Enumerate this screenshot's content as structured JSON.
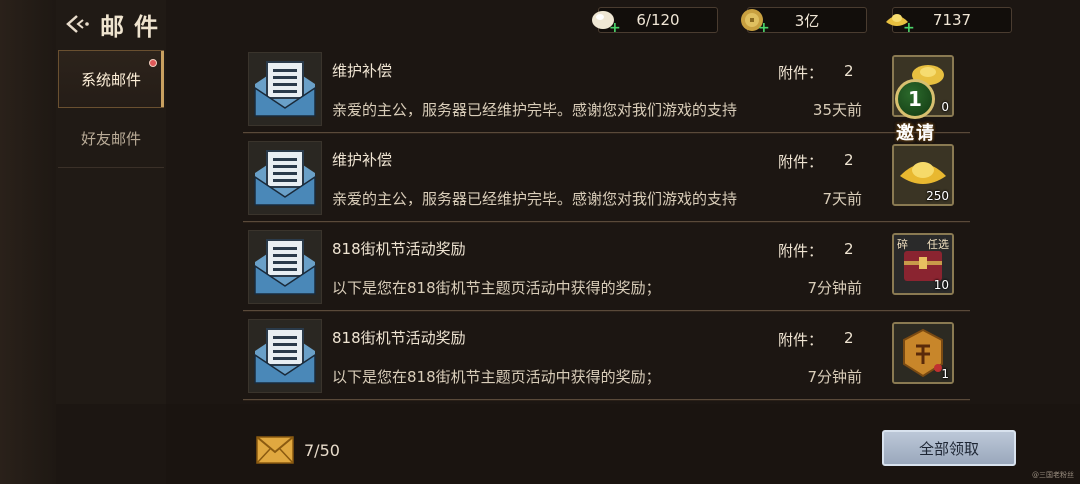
{
  "header": {
    "title": "邮件"
  },
  "sidebar": {
    "items": [
      {
        "label": "系统邮件",
        "active": true,
        "has_dot": true
      },
      {
        "label": "好友邮件",
        "active": false,
        "has_dot": false
      }
    ]
  },
  "resources": [
    {
      "icon": "pearl-icon",
      "value": "6/120"
    },
    {
      "icon": "coin-icon",
      "value": "3亿"
    },
    {
      "icon": "gold-ingot-icon",
      "value": "7137"
    }
  ],
  "mails": [
    {
      "title": "维护补偿",
      "attach_label": "附件：",
      "attach_count": "2",
      "body": "亲爱的主公，服务器已经维护完毕。感谢您对我们游戏的支持",
      "time": "35天前",
      "reward_icon": "gold-ingot-pile-icon",
      "reward_count": "0"
    },
    {
      "title": "维护补偿",
      "attach_label": "附件：",
      "attach_count": "2",
      "body": "亲爱的主公，服务器已经维护完毕。感谢您对我们游戏的支持",
      "time": "7天前",
      "reward_icon": "gold-ingot-icon",
      "reward_count": "250"
    },
    {
      "title": "818街机节活动奖励",
      "attach_label": "附件：",
      "attach_count": "2",
      "body": "以下是您在818街机节主题页活动中获得的奖励；",
      "time": "7分钟前",
      "reward_icon": "treasure-chest-icon",
      "reward_count": "10",
      "reward_tag_left": "碎",
      "reward_tag_right": "任选"
    },
    {
      "title": "818街机节活动奖励",
      "attach_label": "附件：",
      "attach_count": "2",
      "body": "以下是您在818街机节主题页活动中获得的奖励；",
      "time": "7分钟前",
      "reward_icon": "token-badge-icon",
      "reward_count": "1"
    }
  ],
  "invite": {
    "number": "1",
    "label": "邀请"
  },
  "footer": {
    "mail_count": "7/50",
    "claim_all_label": "全部领取",
    "watermark": "@三国老粉丝"
  }
}
